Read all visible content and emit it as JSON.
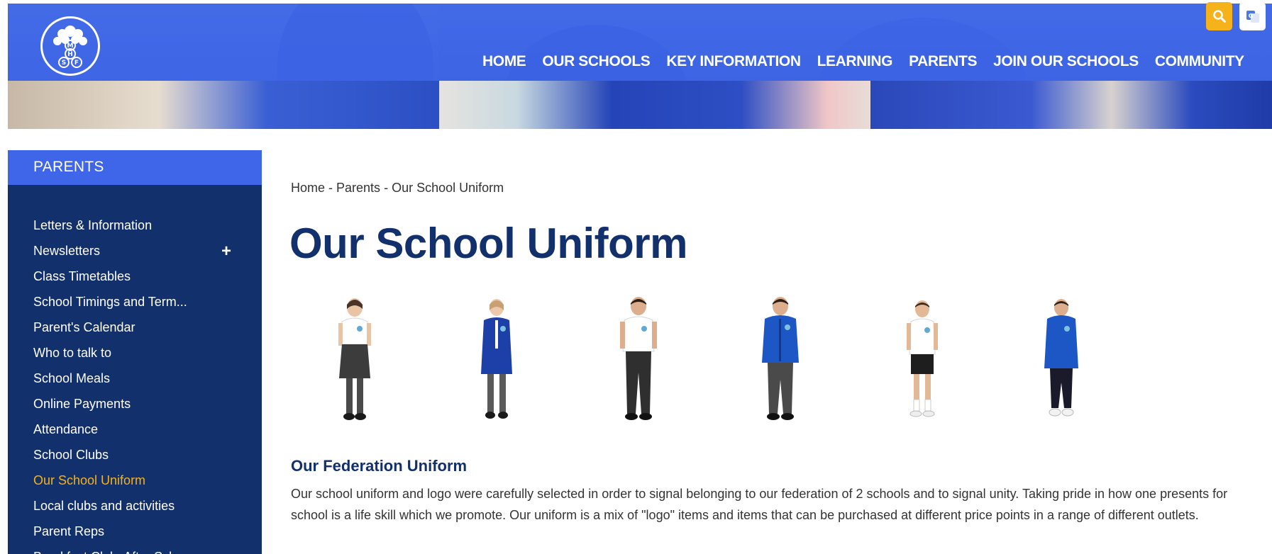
{
  "header": {
    "logo_letters": [
      "M",
      "H",
      "S",
      "F"
    ],
    "nav": [
      "HOME",
      "OUR SCHOOLS",
      "KEY INFORMATION",
      "LEARNING",
      "PARENTS",
      "JOIN OUR SCHOOLS",
      "COMMUNITY"
    ],
    "search_icon": "search-icon",
    "translate_icon": "translate-icon"
  },
  "colors": {
    "brand_blue": "#3f66e8",
    "navy": "#12306b",
    "accent_yellow": "#f6b21a"
  },
  "sidebar": {
    "heading": "PARENTS",
    "items": [
      {
        "label": "Letters & Information"
      },
      {
        "label": "Newsletters",
        "expander": "+"
      },
      {
        "label": "Class Timetables"
      },
      {
        "label": "School Timings and Term..."
      },
      {
        "label": "Parent's Calendar"
      },
      {
        "label": "Who to talk to"
      },
      {
        "label": "School Meals"
      },
      {
        "label": "Online Payments"
      },
      {
        "label": "Attendance"
      },
      {
        "label": "School Clubs"
      },
      {
        "label": "Our School Uniform",
        "active": true
      },
      {
        "label": "Local clubs and activities"
      },
      {
        "label": "Parent Reps"
      },
      {
        "label": "Breakfast Club, After Sch..."
      }
    ]
  },
  "breadcrumb": {
    "items": [
      "Home",
      "Parents",
      "Our School Uniform"
    ],
    "separator": "-"
  },
  "main": {
    "title": "Our School Uniform",
    "section_heading": "Our Federation Uniform",
    "paragraph": "Our school uniform and logo were carefully selected in order to signal belonging to our federation of 2 schools and to signal unity.  Taking pride in how one presents for school is a life skill which we promote.  Our uniform is a mix of \"logo\" items and items that can be purchased at different price points in a range of different outlets."
  }
}
